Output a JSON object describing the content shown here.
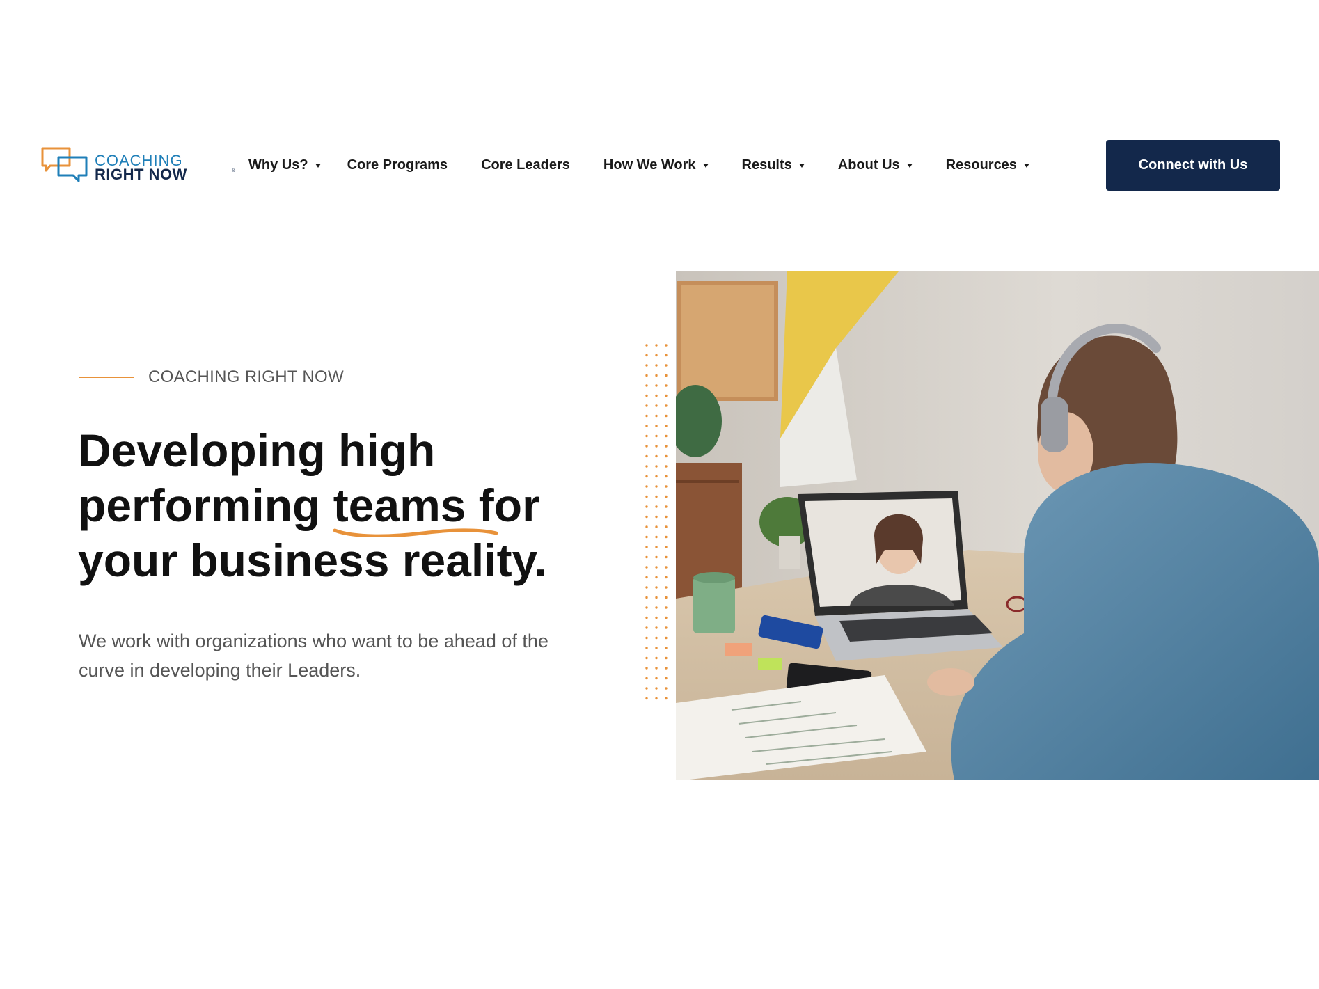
{
  "brand": {
    "line1": "COACHING",
    "line2": "RIGHT NOW",
    "registered": "®",
    "colors": {
      "navy": "#13284b",
      "blue": "#1f7fb8",
      "orange": "#e8923a"
    }
  },
  "nav": {
    "items": [
      {
        "label": "Why Us?",
        "has_dropdown": true
      },
      {
        "label": "Core Programs",
        "has_dropdown": false
      },
      {
        "label": "Core Leaders",
        "has_dropdown": false
      },
      {
        "label": "How We Work",
        "has_dropdown": true
      },
      {
        "label": "Results",
        "has_dropdown": true
      },
      {
        "label": "About Us",
        "has_dropdown": true
      },
      {
        "label": "Resources",
        "has_dropdown": true
      }
    ],
    "cta_label": "Connect with Us"
  },
  "hero": {
    "eyebrow": "COACHING RIGHT NOW",
    "headline_part1": "Developing high performing ",
    "headline_highlight": "teams",
    "headline_part2": " for your business reality.",
    "subtext": "We work with organizations who want to be ahead of the curve in developing their Leaders."
  },
  "icons": {
    "logo": "speech-bubbles-icon",
    "dropdown": "caret-down-icon"
  }
}
